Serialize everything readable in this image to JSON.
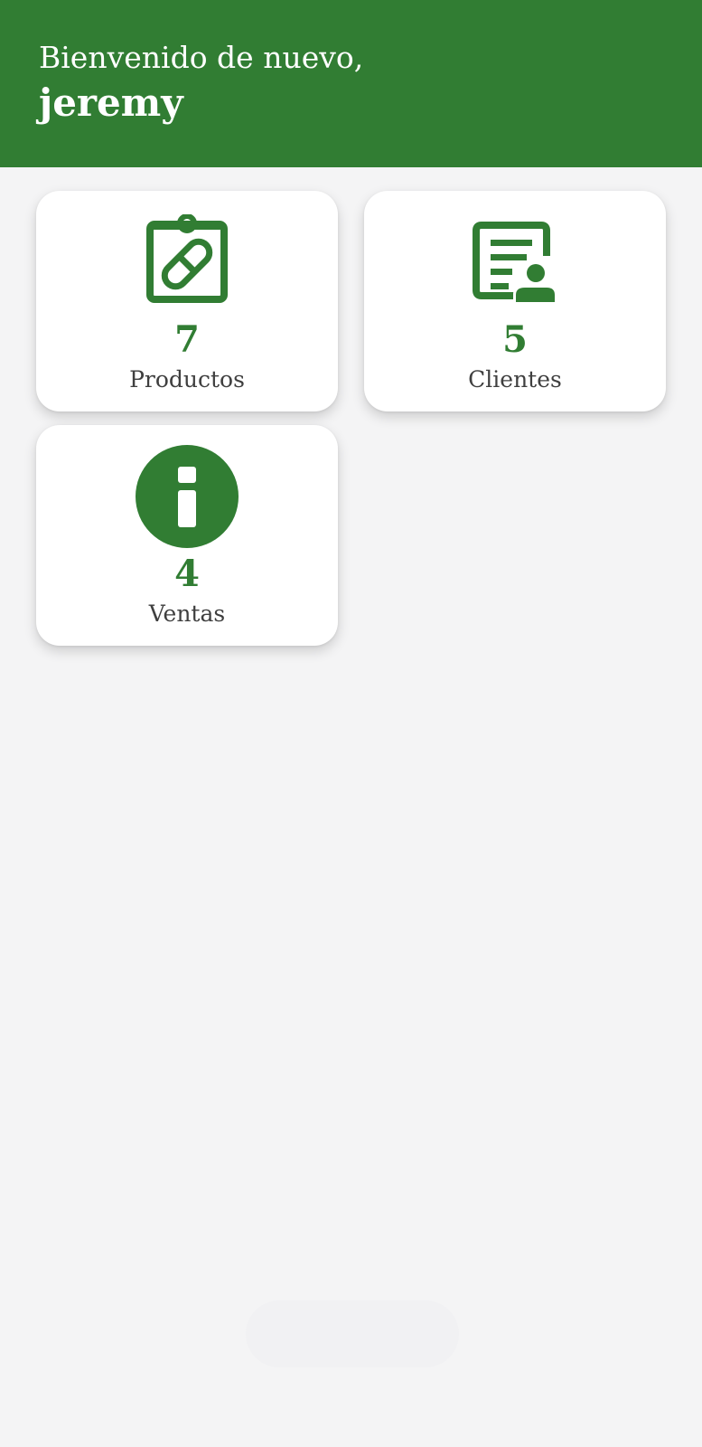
{
  "header": {
    "greeting": "Bienvenido de nuevo,",
    "username": "jeremy"
  },
  "cards": [
    {
      "label": "Productos",
      "count": "7",
      "icon": "clipboard-pill-icon"
    },
    {
      "label": "Clientes",
      "count": "5",
      "icon": "contact-list-icon"
    },
    {
      "label": "Ventas",
      "count": "4",
      "icon": "info-icon"
    }
  ],
  "colors": {
    "primary": "#317d33",
    "background": "#f4f4f5",
    "card": "#ffffff",
    "label_text": "#3f3f3f"
  }
}
